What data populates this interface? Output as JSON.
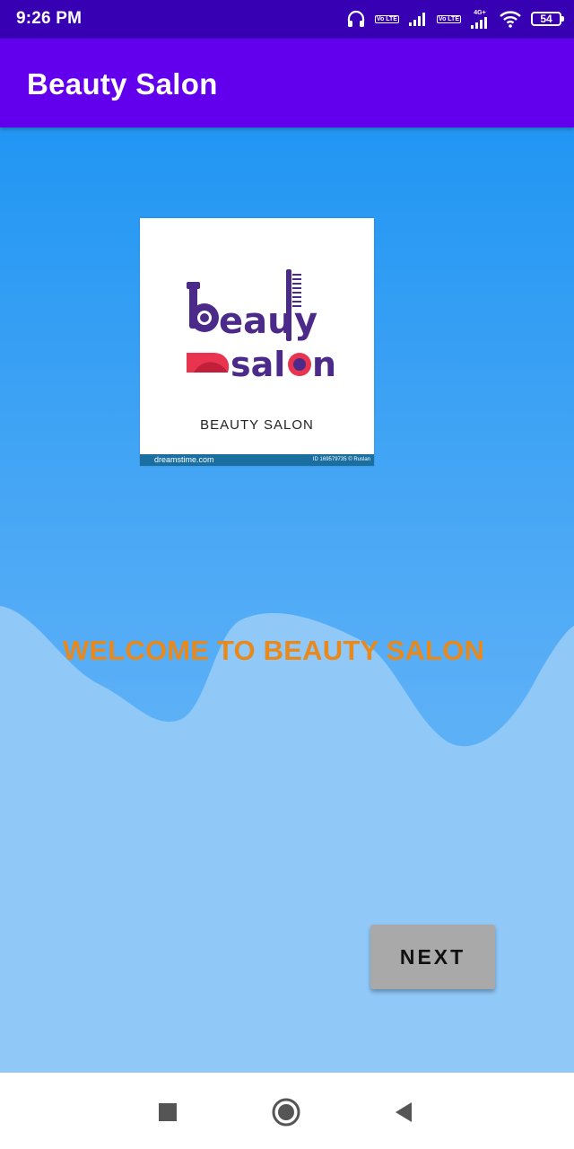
{
  "status_bar": {
    "time": "9:26 PM",
    "battery": "54",
    "net1": "Vo LTE",
    "net2": "Vo LTE",
    "net2_label": "4G+",
    "icons": [
      "headphones-icon",
      "signal-icon",
      "signal-icon",
      "wifi-icon",
      "battery-icon"
    ]
  },
  "app_bar": {
    "title": "Beauty Salon"
  },
  "logo": {
    "caption": "BEAUTY SALON",
    "footer_site": "dreamstime.com",
    "footer_id": "ID 169579735 © Ruslan"
  },
  "main": {
    "welcome": "WELCOME TO BEAUTY SALON",
    "next_label": "NEXT"
  },
  "colors": {
    "status_bar": "#3700b3",
    "app_bar": "#6200ee",
    "background_top": "#2196f3",
    "wave": "#90c8f8",
    "welcome_text": "#e8891d",
    "button": "#a9a9a9"
  },
  "nav": {
    "icons": [
      "recents-square-icon",
      "home-circle-icon",
      "back-triangle-icon"
    ]
  }
}
